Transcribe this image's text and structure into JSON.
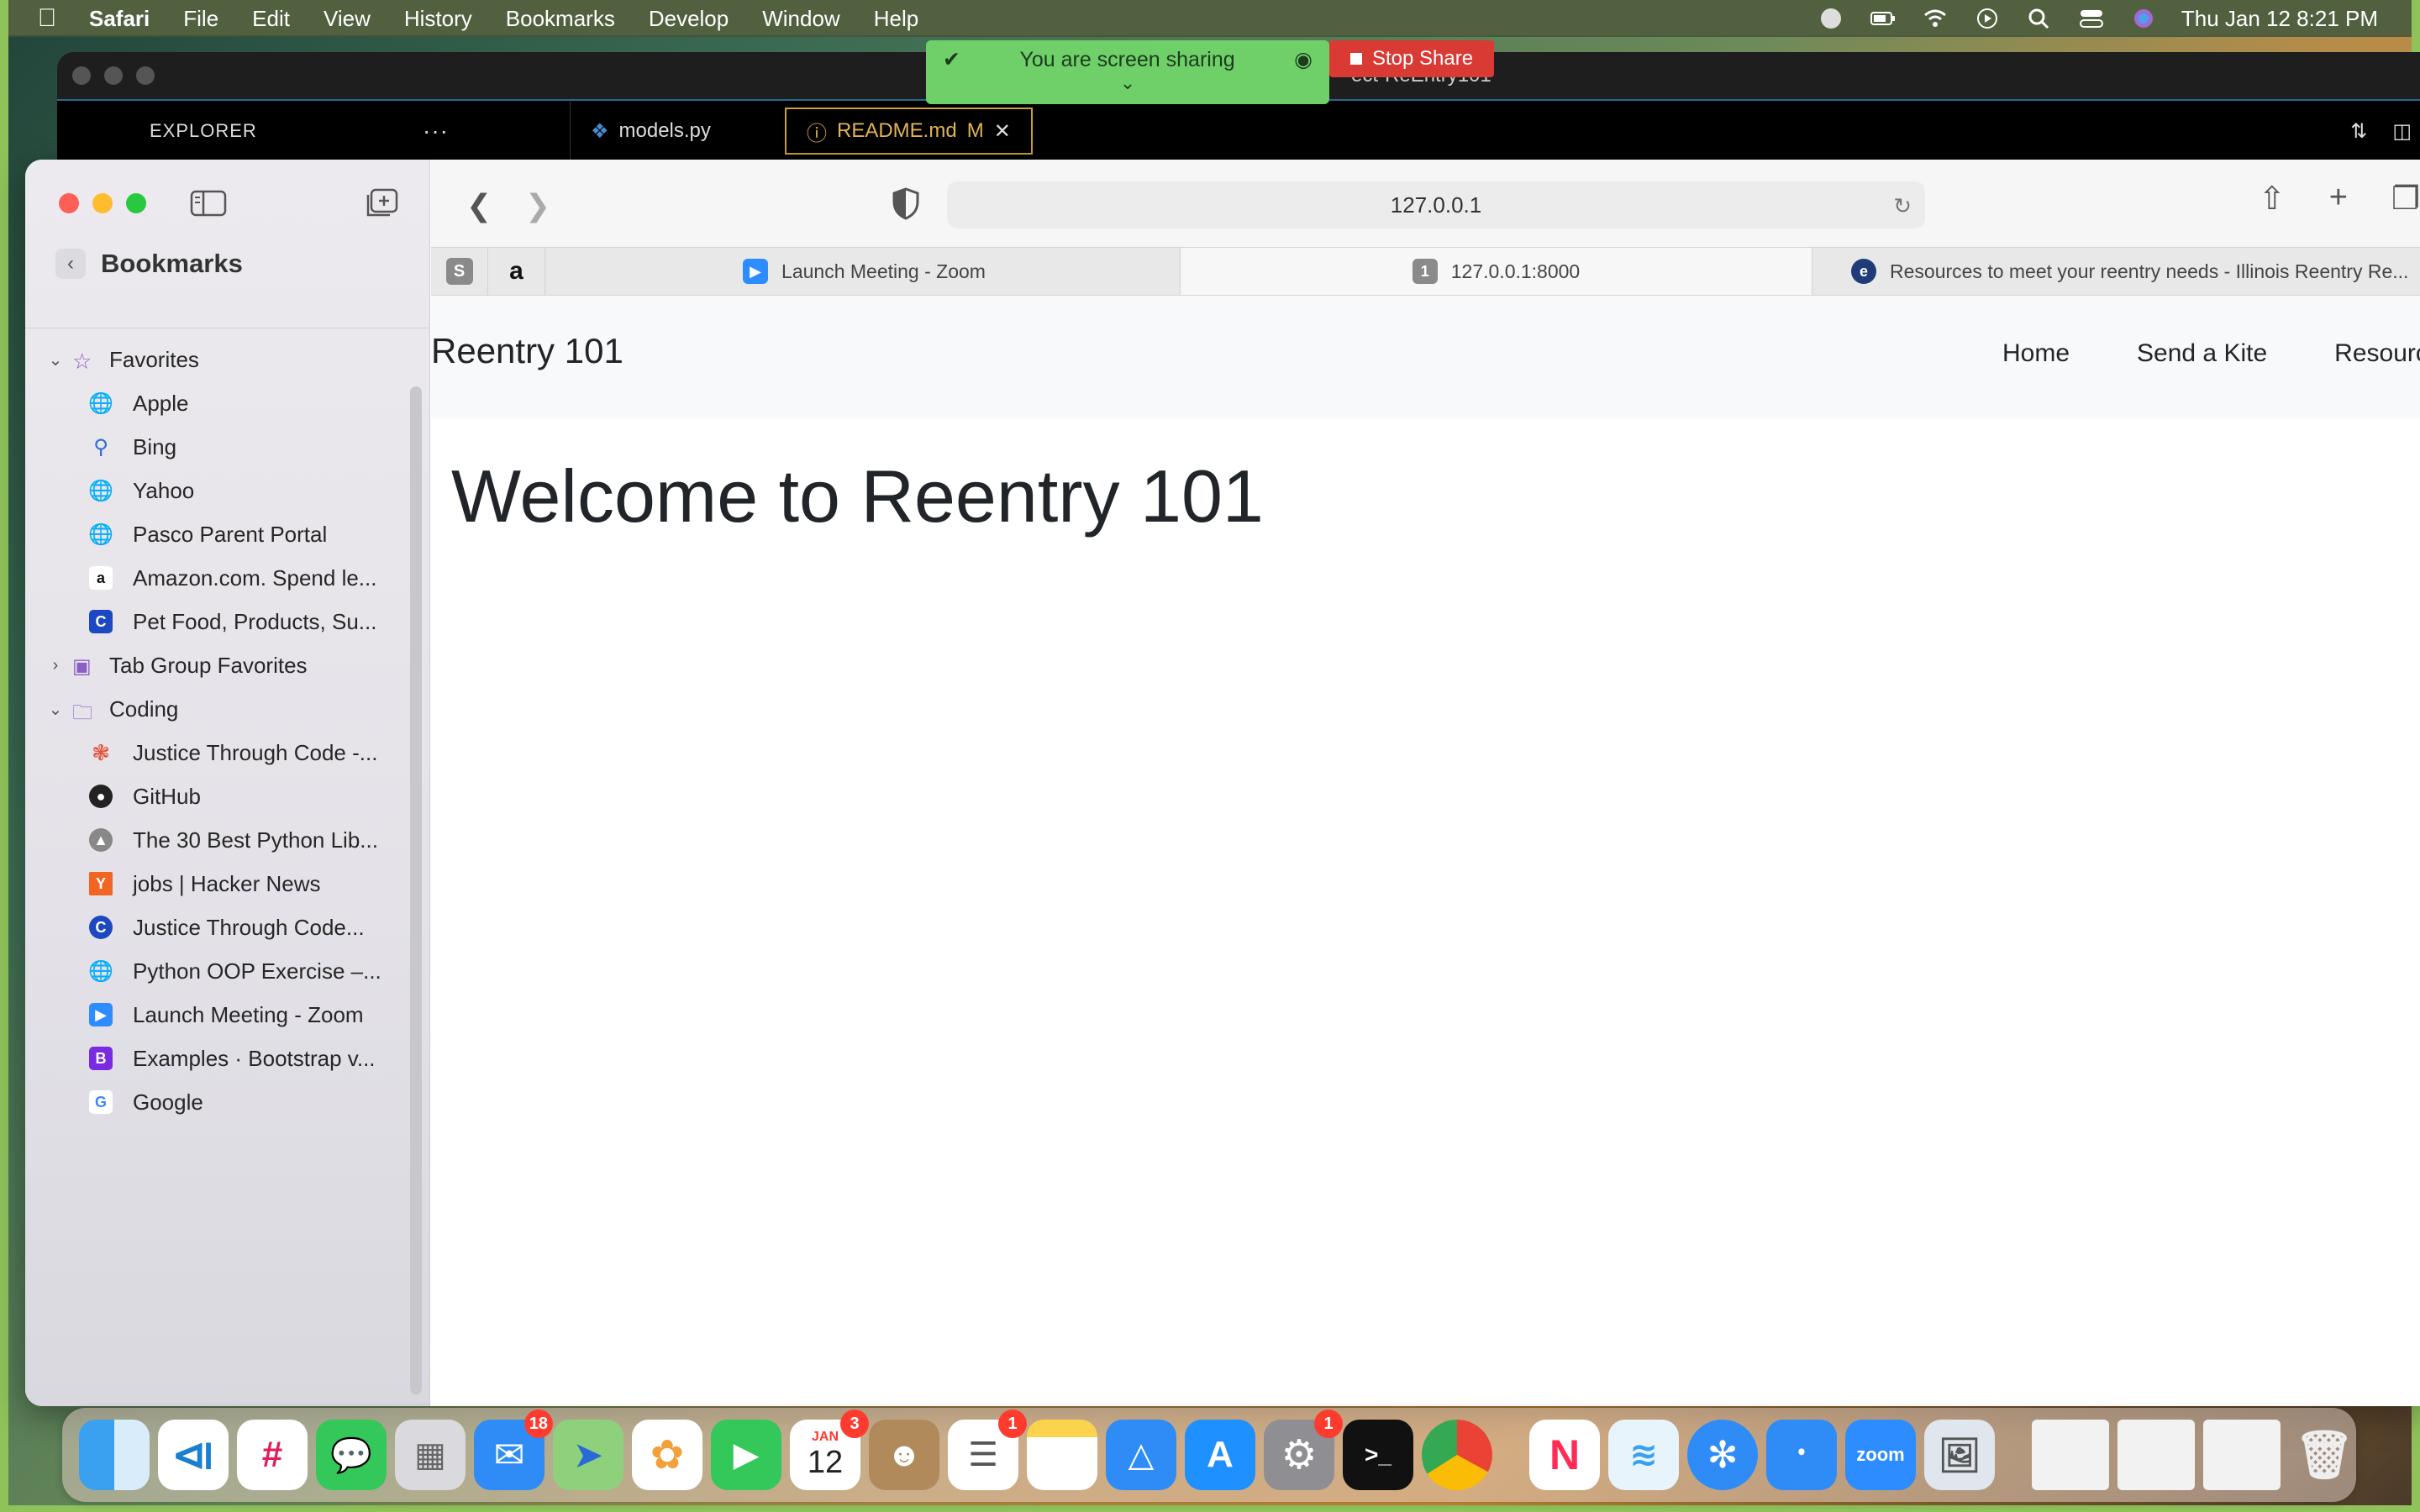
{
  "menubar": {
    "app": "Safari",
    "items": [
      "File",
      "Edit",
      "View",
      "History",
      "Bookmarks",
      "Develop",
      "Window",
      "Help"
    ],
    "clock": "Thu Jan 12  8:21 PM"
  },
  "vscode": {
    "title": "ect-ReEntry101",
    "explorer": "EXPLORER",
    "more": "···",
    "tabs": [
      {
        "label": "models.py"
      },
      {
        "label": "README.md",
        "modified": "M"
      }
    ]
  },
  "share": {
    "message": "You are screen sharing",
    "stop_label": "Stop Share"
  },
  "sidebar": {
    "title": "Bookmarks",
    "groups": [
      {
        "label": "Favorites",
        "expanded": true,
        "items": [
          {
            "label": "Apple",
            "icon": "globe-icon"
          },
          {
            "label": "Bing",
            "icon": "search-icon"
          },
          {
            "label": "Yahoo",
            "icon": "globe-icon"
          },
          {
            "label": "Pasco Parent Portal",
            "icon": "globe-icon"
          },
          {
            "label": "Amazon.com. Spend le...",
            "icon": "amazon-icon"
          },
          {
            "label": "Pet Food, Products, Su...",
            "icon": "chewy-icon"
          }
        ]
      },
      {
        "label": "Tab Group Favorites",
        "expanded": false,
        "items": []
      },
      {
        "label": "Coding",
        "expanded": true,
        "items": [
          {
            "label": "Justice Through Code -...",
            "icon": "jtc-icon"
          },
          {
            "label": "GitHub",
            "icon": "github-icon"
          },
          {
            "label": "The 30 Best Python Lib...",
            "icon": "python-icon"
          },
          {
            "label": "jobs | Hacker News",
            "icon": "hackernews-icon"
          },
          {
            "label": "Justice Through Code...",
            "icon": "chewy-icon"
          },
          {
            "label": "Python OOP Exercise –...",
            "icon": "globe-icon"
          },
          {
            "label": "Launch Meeting - Zoom",
            "icon": "zoom-icon"
          },
          {
            "label": "Examples · Bootstrap v...",
            "icon": "bootstrap-icon"
          },
          {
            "label": "Google",
            "icon": "google-icon"
          }
        ]
      }
    ]
  },
  "toolbar": {
    "url": "127.0.0.1"
  },
  "tabs": {
    "pinned": [
      "S",
      "a"
    ],
    "items": [
      {
        "label": "Launch Meeting - Zoom",
        "icon": "zoom-icon",
        "active": false
      },
      {
        "label": "127.0.0.1:8000",
        "icon_text": "1",
        "active": true
      },
      {
        "label": "Resources to meet your reentry needs - Illinois Reentry Re...",
        "icon": "reentry-icon",
        "active": false
      }
    ]
  },
  "page": {
    "brand": "Reentry 101",
    "nav": [
      "Home",
      "Send a Kite",
      "Resource"
    ],
    "heading": "Welcome to Reentry 101"
  },
  "dock": {
    "mail_badge": "18",
    "calendar_month": "JAN",
    "calendar_day": "12",
    "calendar_badge": "3",
    "reminders_badge": "1",
    "settings_badge": "1",
    "zoom_label": "zoom"
  }
}
